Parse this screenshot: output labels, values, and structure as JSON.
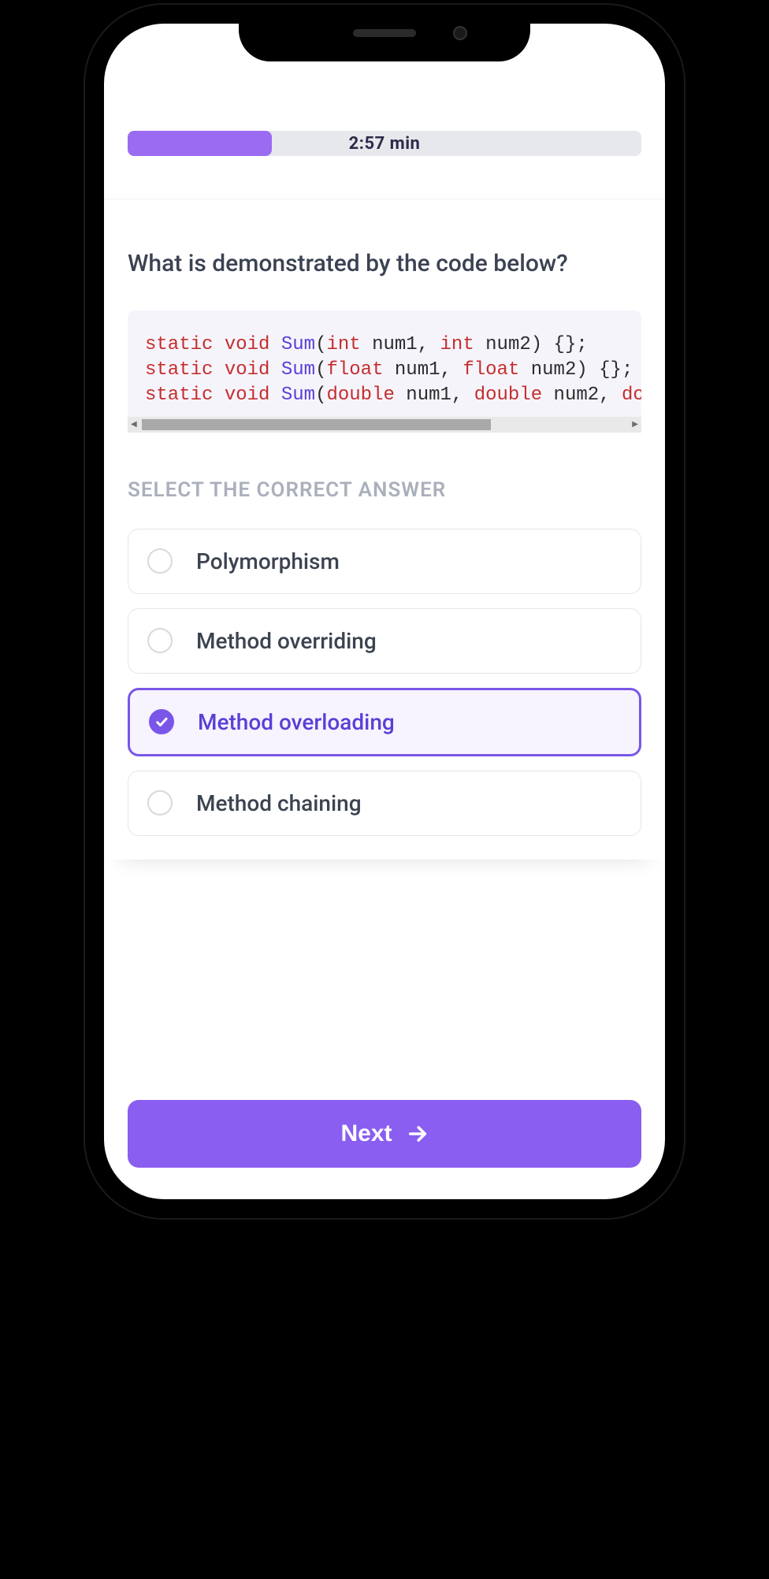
{
  "colors": {
    "accent": "#8a5ef0",
    "accent_light": "#9b6bf2",
    "selected_border": "#7a56e8",
    "selected_bg": "#f7f3ff"
  },
  "timer": {
    "label": "2:57 min",
    "progress_percent": 28
  },
  "question": {
    "text": "What is demonstrated by the code below?"
  },
  "code": {
    "lines": [
      [
        {
          "t": "static",
          "c": "kw"
        },
        {
          "t": " ",
          "c": "punc"
        },
        {
          "t": "void",
          "c": "kw"
        },
        {
          "t": " ",
          "c": "punc"
        },
        {
          "t": "Sum",
          "c": "fn"
        },
        {
          "t": "(",
          "c": "punc"
        },
        {
          "t": "int",
          "c": "type"
        },
        {
          "t": " num1, ",
          "c": "id"
        },
        {
          "t": "int",
          "c": "type"
        },
        {
          "t": " num2) {};",
          "c": "id"
        }
      ],
      [
        {
          "t": "static",
          "c": "kw"
        },
        {
          "t": " ",
          "c": "punc"
        },
        {
          "t": "void",
          "c": "kw"
        },
        {
          "t": " ",
          "c": "punc"
        },
        {
          "t": "Sum",
          "c": "fn"
        },
        {
          "t": "(",
          "c": "punc"
        },
        {
          "t": "float",
          "c": "type"
        },
        {
          "t": " num1, ",
          "c": "id"
        },
        {
          "t": "float",
          "c": "type"
        },
        {
          "t": " num2) {};",
          "c": "id"
        }
      ],
      [
        {
          "t": "static",
          "c": "kw"
        },
        {
          "t": " ",
          "c": "punc"
        },
        {
          "t": "void",
          "c": "kw"
        },
        {
          "t": " ",
          "c": "punc"
        },
        {
          "t": "Sum",
          "c": "fn"
        },
        {
          "t": "(",
          "c": "punc"
        },
        {
          "t": "double",
          "c": "type"
        },
        {
          "t": " num1, ",
          "c": "id"
        },
        {
          "t": "double",
          "c": "type"
        },
        {
          "t": " num2, ",
          "c": "id"
        },
        {
          "t": "do",
          "c": "type"
        }
      ]
    ]
  },
  "answers": {
    "prompt": "SELECT THE CORRECT ANSWER",
    "options": [
      {
        "label": "Polymorphism",
        "selected": false
      },
      {
        "label": "Method overriding",
        "selected": false
      },
      {
        "label": "Method overloading",
        "selected": true
      },
      {
        "label": "Method chaining",
        "selected": false
      }
    ]
  },
  "footer": {
    "next_label": "Next"
  }
}
